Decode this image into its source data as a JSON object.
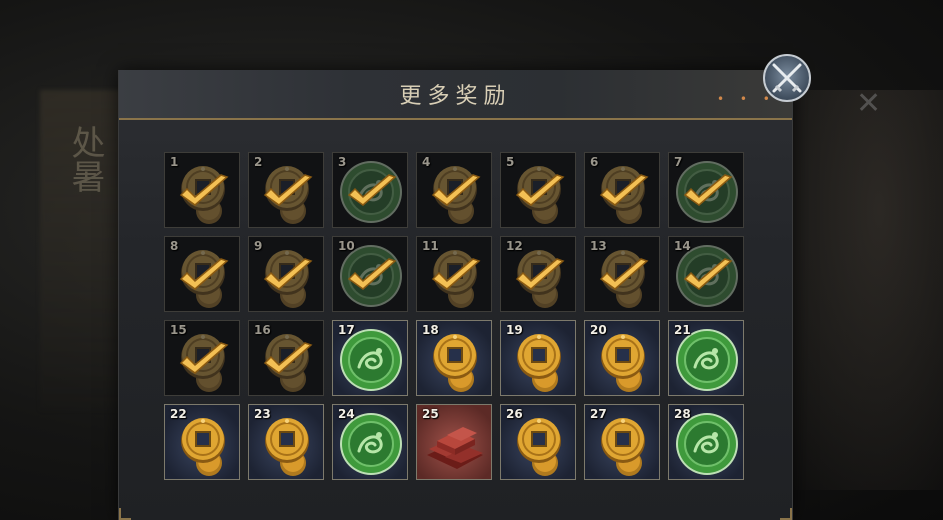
{
  "popup": {
    "title": "更多奖励",
    "close_label": "close"
  },
  "background": {
    "calligraphy": "处暑"
  },
  "colors": {
    "gold": "#e0a632",
    "jade": "#3f9a3c",
    "check": "#f3c054",
    "header_border": "#8a744a"
  },
  "rewards": [
    {
      "num": "1",
      "type": "coin",
      "claimed": true
    },
    {
      "num": "2",
      "type": "coin",
      "claimed": true
    },
    {
      "num": "3",
      "type": "jade",
      "claimed": true
    },
    {
      "num": "4",
      "type": "coin",
      "claimed": true
    },
    {
      "num": "5",
      "type": "coin",
      "claimed": true
    },
    {
      "num": "6",
      "type": "coin",
      "claimed": true
    },
    {
      "num": "7",
      "type": "jade",
      "claimed": true
    },
    {
      "num": "8",
      "type": "coin",
      "claimed": true
    },
    {
      "num": "9",
      "type": "coin",
      "claimed": true
    },
    {
      "num": "10",
      "type": "jade",
      "claimed": true
    },
    {
      "num": "11",
      "type": "coin",
      "claimed": true
    },
    {
      "num": "12",
      "type": "coin",
      "claimed": true
    },
    {
      "num": "13",
      "type": "coin",
      "claimed": true
    },
    {
      "num": "14",
      "type": "jade",
      "claimed": true
    },
    {
      "num": "15",
      "type": "coin",
      "claimed": true
    },
    {
      "num": "16",
      "type": "coin",
      "claimed": true
    },
    {
      "num": "17",
      "type": "jade",
      "claimed": false
    },
    {
      "num": "18",
      "type": "coin",
      "claimed": false
    },
    {
      "num": "19",
      "type": "coin",
      "claimed": false
    },
    {
      "num": "20",
      "type": "coin",
      "claimed": false
    },
    {
      "num": "21",
      "type": "jade",
      "claimed": false
    },
    {
      "num": "22",
      "type": "coin",
      "claimed": false
    },
    {
      "num": "23",
      "type": "coin",
      "claimed": false
    },
    {
      "num": "24",
      "type": "jade",
      "claimed": false
    },
    {
      "num": "25",
      "type": "bricks",
      "claimed": false
    },
    {
      "num": "26",
      "type": "coin",
      "claimed": false
    },
    {
      "num": "27",
      "type": "coin",
      "claimed": false
    },
    {
      "num": "28",
      "type": "jade",
      "claimed": false
    }
  ]
}
